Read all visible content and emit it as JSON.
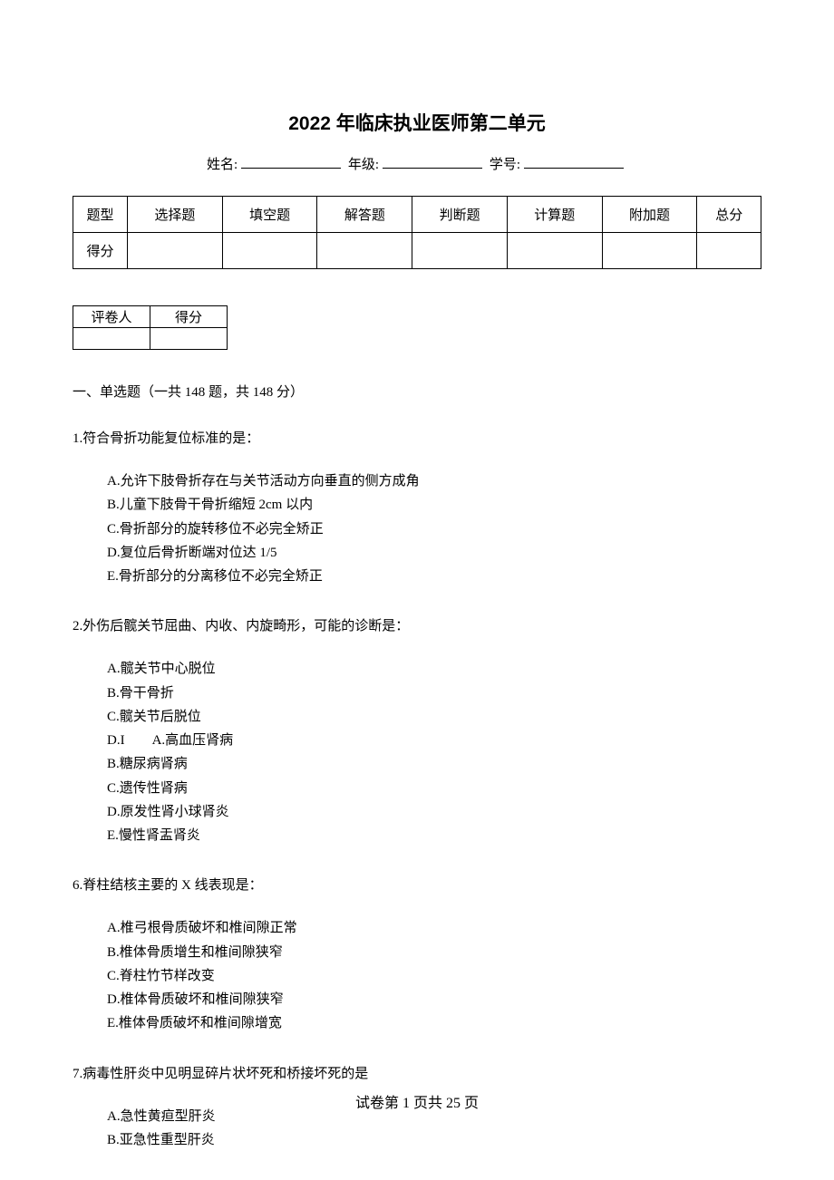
{
  "title": "2022 年临床执业医师第二单元",
  "info": {
    "name_label": "姓名:",
    "grade_label": "年级:",
    "id_label": "学号:"
  },
  "score_table": {
    "row1": [
      "题型",
      "选择题",
      "填空题",
      "解答题",
      "判断题",
      "计算题",
      "附加题",
      "总分"
    ],
    "row2_label": "得分"
  },
  "grader_table": {
    "col1": "评卷人",
    "col2": "得分"
  },
  "section_heading": "一、单选题（一共 148 题，共 148 分）",
  "questions": [
    {
      "text": "1.符合骨折功能复位标准的是：",
      "options": [
        "A.允许下肢骨折存在与关节活动方向垂直的侧方成角",
        "B.儿童下肢骨干骨折缩短 2cm 以内",
        "C.骨折部分的旋转移位不必完全矫正",
        "D.复位后骨折断端对位达 1/5",
        "E.骨折部分的分离移位不必完全矫正"
      ]
    },
    {
      "text": "2.外伤后髋关节屈曲、内收、内旋畸形，可能的诊断是：",
      "options": [
        "A.髋关节中心脱位",
        "B.骨干骨折",
        "C.髋关节后脱位",
        "D.I　　A.高血压肾病",
        "B.糖尿病肾病",
        "C.遗传性肾病",
        "D.原发性肾小球肾炎",
        "E.慢性肾盂肾炎"
      ]
    },
    {
      "text": "6.脊柱结核主要的 X 线表现是：",
      "options": [
        "A.椎弓根骨质破坏和椎间隙正常",
        "B.椎体骨质增生和椎间隙狭窄",
        "C.脊柱竹节样改变",
        "D.椎体骨质破坏和椎间隙狭窄",
        "E.椎体骨质破坏和椎间隙增宽"
      ]
    },
    {
      "text": "7.病毒性肝炎中见明显碎片状坏死和桥接坏死的是",
      "options": [
        "A.急性黄疸型肝炎",
        "B.亚急性重型肝炎"
      ]
    }
  ],
  "footer": "试卷第 1 页共 25 页"
}
